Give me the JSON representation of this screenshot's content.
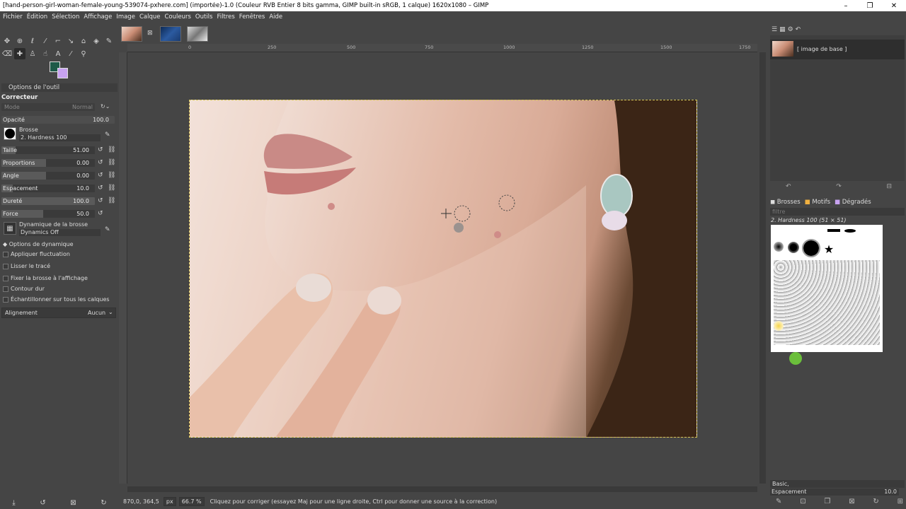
{
  "window": {
    "title": "[hand-person-girl-woman-female-young-539074-pxhere.com] (importée)-1.0 (Couleur RVB Entier 8 bits gamma, GIMP built-in sRGB, 1 calque) 1620x1080 – GIMP"
  },
  "menu": [
    "Fichier",
    "Édition",
    "Sélection",
    "Affichage",
    "Image",
    "Calque",
    "Couleurs",
    "Outils",
    "Filtres",
    "Fenêtres",
    "Aide"
  ],
  "tool_options": {
    "tab_label": "Options de l'outil",
    "tool_name": "Correcteur",
    "mode_label": "Mode",
    "mode_value": "Normal",
    "opacity_label": "Opacité",
    "opacity_value": "100.0",
    "brush_label": "Brosse",
    "brush_value": "2. Hardness 100",
    "sliders": [
      {
        "label": "Taille",
        "value": "51.00",
        "fill": 0.5
      },
      {
        "label": "Proportions",
        "value": "0.00",
        "fill": 0.5
      },
      {
        "label": "Angle",
        "value": "0.00",
        "fill": 0.5
      },
      {
        "label": "Espacement",
        "value": "10.0",
        "fill": 0.1
      },
      {
        "label": "Dureté",
        "value": "100.0",
        "fill": 1.0
      },
      {
        "label": "Force",
        "value": "50.0",
        "fill": 0.5
      }
    ],
    "dynamics_label": "Dynamique de la brosse",
    "dynamics_value": "Dynamics Off",
    "dynamics_options": "Options de dynamique",
    "checkboxes": [
      "Appliquer fluctuation",
      "Lisser le tracé",
      "Fixer la brosse à l'affichage",
      "Contour dur",
      "Échantillonner sur tous les calques"
    ],
    "alignment_label": "Alignement",
    "alignment_value": "Aucun"
  },
  "ruler": {
    "h_ticks": [
      "0",
      "250",
      "500",
      "750",
      "1000",
      "1250",
      "1500",
      "1750"
    ]
  },
  "status": {
    "coords": "870,0, 364,5",
    "unit": "px",
    "zoom": "66.7 %",
    "message": "Cliquez pour corriger (essayez Maj pour une ligne droite, Ctrl pour donner une source à la correction)"
  },
  "layers": {
    "layer_name": "[ image de base ]"
  },
  "brushes": {
    "tabs": [
      "Brosses",
      "Motifs",
      "Dégradés"
    ],
    "filter_placeholder": "filtre",
    "selected": "2. Hardness 100 (51 × 51)",
    "tag_value": "Basic,",
    "spacing_label": "Espacement",
    "spacing_value": "10.0"
  },
  "colors": {
    "foreground": "#1e5a48",
    "background": "#c7a2f0"
  }
}
